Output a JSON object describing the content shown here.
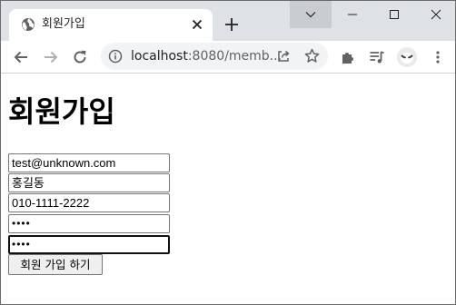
{
  "browser": {
    "tab": {
      "title": "회원가입",
      "favicon": "globe-icon",
      "close_icon": "close-icon"
    },
    "new_tab_icon": "plus-icon",
    "window_controls": [
      "chevron-down-icon",
      "minimize-icon",
      "maximize-icon",
      "close-icon"
    ],
    "toolbar": {
      "back_icon": "back-arrow-icon",
      "forward_icon": "forward-arrow-icon",
      "reload_icon": "reload-icon",
      "address": {
        "info_icon": "info-icon",
        "url_host": "localhost",
        "url_rest": ":8080/memb...",
        "share_icon": "share-icon",
        "bookmark_icon": "star-icon"
      },
      "extensions_icon": "puzzle-icon",
      "reading_list_icon": "reading-list-icon",
      "profile_icon": "avatar-icon",
      "menu_icon": "kebab-menu-icon"
    }
  },
  "page": {
    "title": "회원가입",
    "form": {
      "email": {
        "value": "test@unknown.com"
      },
      "name": {
        "value": "홍길동"
      },
      "phone": {
        "value": "010-1111-2222"
      },
      "password": {
        "value": "••••"
      },
      "password_confirm": {
        "value": "••••"
      },
      "submit_label": "회원 가입 하기"
    }
  },
  "colors": {
    "tabstrip_bg": "#dee1e6",
    "omnibox_bg": "#f1f3f4",
    "icon_color": "#5f6368",
    "input_border": "#767676",
    "button_bg": "#efefef"
  }
}
